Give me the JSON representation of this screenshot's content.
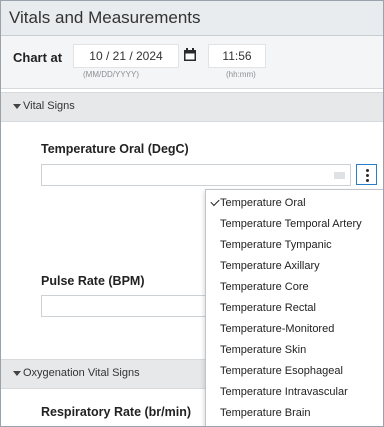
{
  "window": {
    "title": "Vitals and Measurements"
  },
  "chart_at": {
    "label": "Chart at",
    "date_value": "10  /  21  /  2024",
    "date_hint": "(MM/DD/YYYY)",
    "time_value": "11:56",
    "time_hint": "(hh:mm)"
  },
  "sections": {
    "vital_signs": "Vital Signs",
    "oxygenation": "Oxygenation Vital Signs"
  },
  "fields": {
    "temperature": "Temperature Oral (DegC)",
    "pulse_rate": "Pulse Rate (BPM)",
    "respiratory_rate": "Respiratory Rate (br/min)"
  },
  "temperature_menu": {
    "selected": "Temperature Oral",
    "items": [
      "Temperature Oral",
      "Temperature Temporal Artery",
      "Temperature Tympanic",
      "Temperature Axillary",
      "Temperature Core",
      "Temperature Rectal",
      "Temperature-Monitored",
      "Temperature Skin",
      "Temperature Esophageal",
      "Temperature Intravascular",
      "Temperature Brain"
    ]
  }
}
